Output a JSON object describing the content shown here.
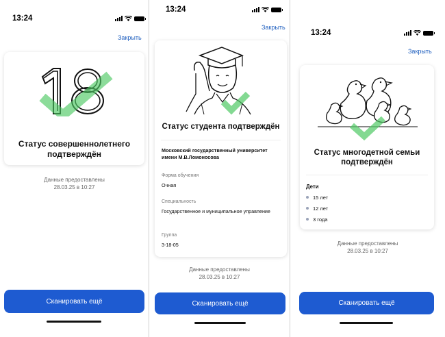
{
  "status_bar": {
    "time": "13:24"
  },
  "close_label": "Закрыть",
  "provided_label": "Данные предоставлены",
  "provided_date": "28.03.25 в 10:27",
  "scan_button": "Сканировать ещё",
  "screen_adult": {
    "illustration_number": "18",
    "title": "Статус совершеннолетнего подтверждён"
  },
  "screen_student": {
    "title": "Статус студента подтверждён",
    "university": "Московский государственный университет имени М.В.Ломоносова",
    "fields": [
      {
        "label": "Форма обучения",
        "value": "Очная"
      },
      {
        "label": "Специальность",
        "value": "Государственное и муниципальное управление"
      },
      {
        "label": "Группа",
        "value": "3-18-05"
      }
    ]
  },
  "screen_family": {
    "title": "Статус многодетной семьи подтверждён",
    "children_heading": "Дети",
    "children": [
      "15 лет",
      "12 лет",
      "3 года"
    ]
  },
  "colors": {
    "accent": "#1e5bd1",
    "link": "#1f5fbf",
    "check": "#4fc964"
  }
}
